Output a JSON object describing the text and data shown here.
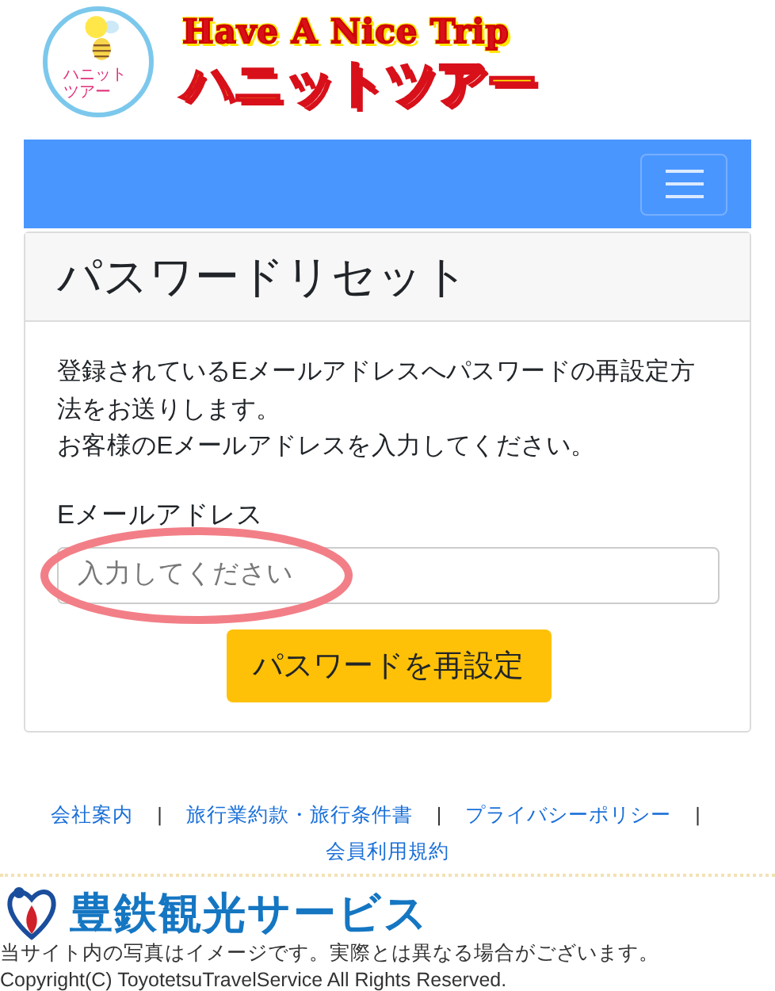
{
  "header": {
    "badge_text": [
      "ハニット",
      "ツアー"
    ],
    "logo_en": "Have A Nice Trip",
    "logo_ja": "ハニットツアー"
  },
  "navbar": {
    "menu_expanded": false
  },
  "card": {
    "title": "パスワードリセット",
    "message": [
      "登録されているEメールアドレスへパスワードの再設定方法をお送りします。",
      "お客様のEメールアドレスを入力してください。"
    ],
    "field": {
      "label": "Eメールアドレス",
      "placeholder": "入力してください",
      "annotation": {
        "kind": "ellipse"
      }
    },
    "submit": "パスワードを再設定"
  },
  "footer": {
    "links": [
      "会社案内",
      "旅行業約款・旅行条件書",
      "プライバシーポリシー",
      "会員利用規約"
    ],
    "separator": "|",
    "company": "豊鉄観光サービス",
    "notice": "当サイト内の写真はイメージです。実際とは異なる場合がございます。",
    "copyright": "Copyright(C) ToyotetsuTravelService All Rights Reserved."
  }
}
